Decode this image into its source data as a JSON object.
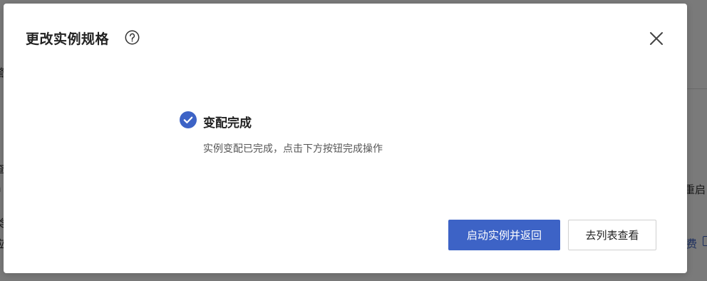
{
  "background": {
    "fragments": [
      "警",
      "查",
      "h",
      "类",
      "应"
    ],
    "right_text": "重启",
    "right_link": "费"
  },
  "dialog": {
    "title": "更改实例规格",
    "help_icon": "question-circle-icon",
    "close_icon": "close-icon",
    "status": {
      "icon": "check-circle-icon",
      "title": "变配完成",
      "description": "实例变配已完成，点击下方按钮完成操作"
    },
    "buttons": {
      "primary": "启动实例并返回",
      "secondary": "去列表查看"
    }
  },
  "colors": {
    "primary": "#3d63c6",
    "overlay": "rgba(0,0,0,0.52)"
  }
}
